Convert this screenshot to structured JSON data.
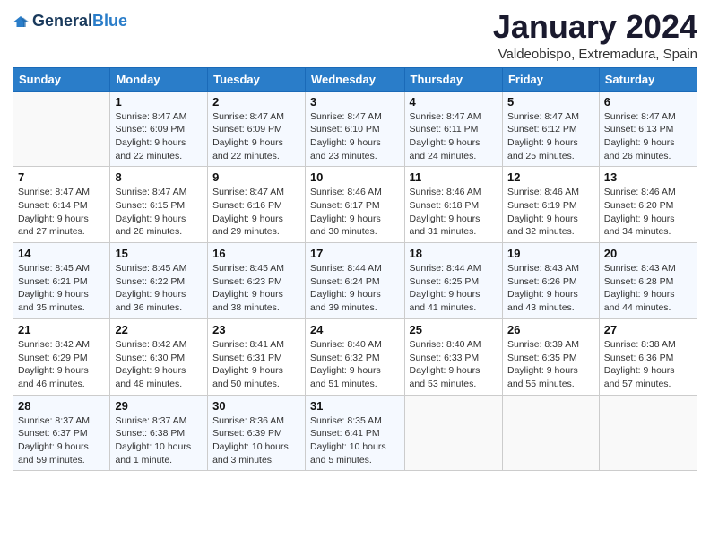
{
  "header": {
    "logo_line1": "General",
    "logo_line2": "Blue",
    "title": "January 2024",
    "location": "Valdeobispo, Extremadura, Spain"
  },
  "columns": [
    "Sunday",
    "Monday",
    "Tuesday",
    "Wednesday",
    "Thursday",
    "Friday",
    "Saturday"
  ],
  "weeks": [
    [
      {
        "day": "",
        "info": ""
      },
      {
        "day": "1",
        "info": "Sunrise: 8:47 AM\nSunset: 6:09 PM\nDaylight: 9 hours\nand 22 minutes."
      },
      {
        "day": "2",
        "info": "Sunrise: 8:47 AM\nSunset: 6:09 PM\nDaylight: 9 hours\nand 22 minutes."
      },
      {
        "day": "3",
        "info": "Sunrise: 8:47 AM\nSunset: 6:10 PM\nDaylight: 9 hours\nand 23 minutes."
      },
      {
        "day": "4",
        "info": "Sunrise: 8:47 AM\nSunset: 6:11 PM\nDaylight: 9 hours\nand 24 minutes."
      },
      {
        "day": "5",
        "info": "Sunrise: 8:47 AM\nSunset: 6:12 PM\nDaylight: 9 hours\nand 25 minutes."
      },
      {
        "day": "6",
        "info": "Sunrise: 8:47 AM\nSunset: 6:13 PM\nDaylight: 9 hours\nand 26 minutes."
      }
    ],
    [
      {
        "day": "7",
        "info": "Sunrise: 8:47 AM\nSunset: 6:14 PM\nDaylight: 9 hours\nand 27 minutes."
      },
      {
        "day": "8",
        "info": "Sunrise: 8:47 AM\nSunset: 6:15 PM\nDaylight: 9 hours\nand 28 minutes."
      },
      {
        "day": "9",
        "info": "Sunrise: 8:47 AM\nSunset: 6:16 PM\nDaylight: 9 hours\nand 29 minutes."
      },
      {
        "day": "10",
        "info": "Sunrise: 8:46 AM\nSunset: 6:17 PM\nDaylight: 9 hours\nand 30 minutes."
      },
      {
        "day": "11",
        "info": "Sunrise: 8:46 AM\nSunset: 6:18 PM\nDaylight: 9 hours\nand 31 minutes."
      },
      {
        "day": "12",
        "info": "Sunrise: 8:46 AM\nSunset: 6:19 PM\nDaylight: 9 hours\nand 32 minutes."
      },
      {
        "day": "13",
        "info": "Sunrise: 8:46 AM\nSunset: 6:20 PM\nDaylight: 9 hours\nand 34 minutes."
      }
    ],
    [
      {
        "day": "14",
        "info": "Sunrise: 8:45 AM\nSunset: 6:21 PM\nDaylight: 9 hours\nand 35 minutes."
      },
      {
        "day": "15",
        "info": "Sunrise: 8:45 AM\nSunset: 6:22 PM\nDaylight: 9 hours\nand 36 minutes."
      },
      {
        "day": "16",
        "info": "Sunrise: 8:45 AM\nSunset: 6:23 PM\nDaylight: 9 hours\nand 38 minutes."
      },
      {
        "day": "17",
        "info": "Sunrise: 8:44 AM\nSunset: 6:24 PM\nDaylight: 9 hours\nand 39 minutes."
      },
      {
        "day": "18",
        "info": "Sunrise: 8:44 AM\nSunset: 6:25 PM\nDaylight: 9 hours\nand 41 minutes."
      },
      {
        "day": "19",
        "info": "Sunrise: 8:43 AM\nSunset: 6:26 PM\nDaylight: 9 hours\nand 43 minutes."
      },
      {
        "day": "20",
        "info": "Sunrise: 8:43 AM\nSunset: 6:28 PM\nDaylight: 9 hours\nand 44 minutes."
      }
    ],
    [
      {
        "day": "21",
        "info": "Sunrise: 8:42 AM\nSunset: 6:29 PM\nDaylight: 9 hours\nand 46 minutes."
      },
      {
        "day": "22",
        "info": "Sunrise: 8:42 AM\nSunset: 6:30 PM\nDaylight: 9 hours\nand 48 minutes."
      },
      {
        "day": "23",
        "info": "Sunrise: 8:41 AM\nSunset: 6:31 PM\nDaylight: 9 hours\nand 50 minutes."
      },
      {
        "day": "24",
        "info": "Sunrise: 8:40 AM\nSunset: 6:32 PM\nDaylight: 9 hours\nand 51 minutes."
      },
      {
        "day": "25",
        "info": "Sunrise: 8:40 AM\nSunset: 6:33 PM\nDaylight: 9 hours\nand 53 minutes."
      },
      {
        "day": "26",
        "info": "Sunrise: 8:39 AM\nSunset: 6:35 PM\nDaylight: 9 hours\nand 55 minutes."
      },
      {
        "day": "27",
        "info": "Sunrise: 8:38 AM\nSunset: 6:36 PM\nDaylight: 9 hours\nand 57 minutes."
      }
    ],
    [
      {
        "day": "28",
        "info": "Sunrise: 8:37 AM\nSunset: 6:37 PM\nDaylight: 9 hours\nand 59 minutes."
      },
      {
        "day": "29",
        "info": "Sunrise: 8:37 AM\nSunset: 6:38 PM\nDaylight: 10 hours\nand 1 minute."
      },
      {
        "day": "30",
        "info": "Sunrise: 8:36 AM\nSunset: 6:39 PM\nDaylight: 10 hours\nand 3 minutes."
      },
      {
        "day": "31",
        "info": "Sunrise: 8:35 AM\nSunset: 6:41 PM\nDaylight: 10 hours\nand 5 minutes."
      },
      {
        "day": "",
        "info": ""
      },
      {
        "day": "",
        "info": ""
      },
      {
        "day": "",
        "info": ""
      }
    ]
  ]
}
